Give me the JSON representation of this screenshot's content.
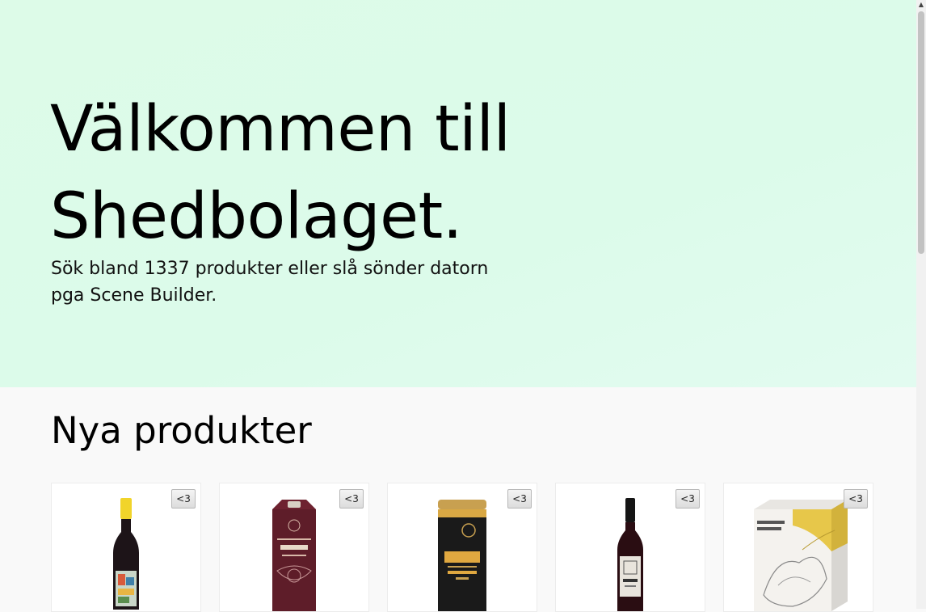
{
  "hero": {
    "title": "Välkommen till Shedbolaget.",
    "subtitle": "Sök bland 1337 produkter eller slå sönder datorn pga Scene Builder."
  },
  "new_products": {
    "title": "Nya produkter",
    "products": [
      {
        "fav_label": "<3",
        "image": "red-wine-bottle-yellow-cap"
      },
      {
        "fav_label": "<3",
        "image": "carignan-wine-carton"
      },
      {
        "fav_label": "<3",
        "image": "dulban-wine-can"
      },
      {
        "fav_label": "<3",
        "image": "zolo-wine-bottle"
      },
      {
        "fav_label": "<3",
        "image": "penley-estate-bag-in-box"
      }
    ]
  },
  "colors": {
    "hero_background": "#ddfbe8",
    "page_background": "#f9f9f9"
  }
}
